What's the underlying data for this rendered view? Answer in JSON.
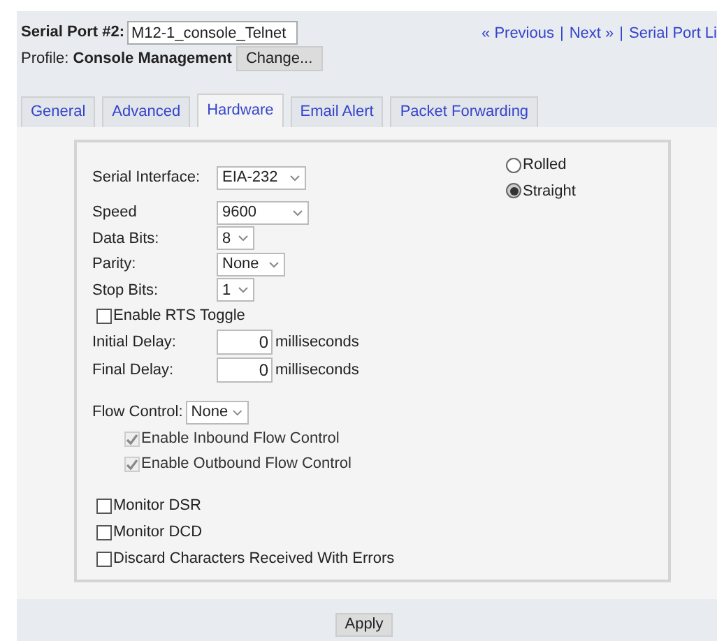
{
  "header": {
    "port_label": "Serial Port #2:",
    "port_name": "M12-1_console_Telnet",
    "profile_label": "Profile:",
    "profile_name": "Console Management",
    "change_button": "Change...",
    "nav": [
      {
        "kind": "link",
        "text": "« Previous"
      },
      {
        "kind": "sep",
        "text": "|"
      },
      {
        "kind": "link",
        "text": "Next »"
      },
      {
        "kind": "sep",
        "text": "|"
      },
      {
        "kind": "link",
        "text": "Serial Port Li"
      }
    ]
  },
  "tabs": [
    {
      "label": "General",
      "selected": false
    },
    {
      "label": "Advanced",
      "selected": false
    },
    {
      "label": "Hardware",
      "selected": true
    },
    {
      "label": "Email Alert",
      "selected": false
    },
    {
      "label": "Packet Forwarding",
      "selected": false
    }
  ],
  "serial_interface": {
    "label": "Serial Interface:",
    "value": "EIA-232"
  },
  "wiring": [
    {
      "label": "Rolled",
      "selected": false
    },
    {
      "label": "Straight",
      "selected": true
    }
  ],
  "settings": [
    {
      "label": "Speed",
      "value": "9600"
    },
    {
      "label": "Data Bits:",
      "value": "8"
    },
    {
      "label": "Parity:",
      "value": "None"
    },
    {
      "label": "Stop Bits:",
      "value": "1"
    }
  ],
  "rts_toggle": {
    "label": "Enable RTS Toggle",
    "checked": false
  },
  "delays": [
    {
      "label": "Initial Delay:",
      "value": "0",
      "unit": "milliseconds"
    },
    {
      "label": "Final Delay:",
      "value": "0",
      "unit": "milliseconds"
    }
  ],
  "flow_control": {
    "label": "Flow Control:",
    "value": "None",
    "options": [
      {
        "label": "Enable Inbound Flow Control",
        "checked": true,
        "disabled": true
      },
      {
        "label": "Enable Outbound Flow Control",
        "checked": true,
        "disabled": true
      }
    ]
  },
  "monitors": [
    {
      "label": "Monitor DSR",
      "checked": false
    },
    {
      "label": "Monitor DCD",
      "checked": false
    },
    {
      "label": "Discard Characters Received With Errors",
      "checked": false
    }
  ],
  "apply_button": "Apply"
}
